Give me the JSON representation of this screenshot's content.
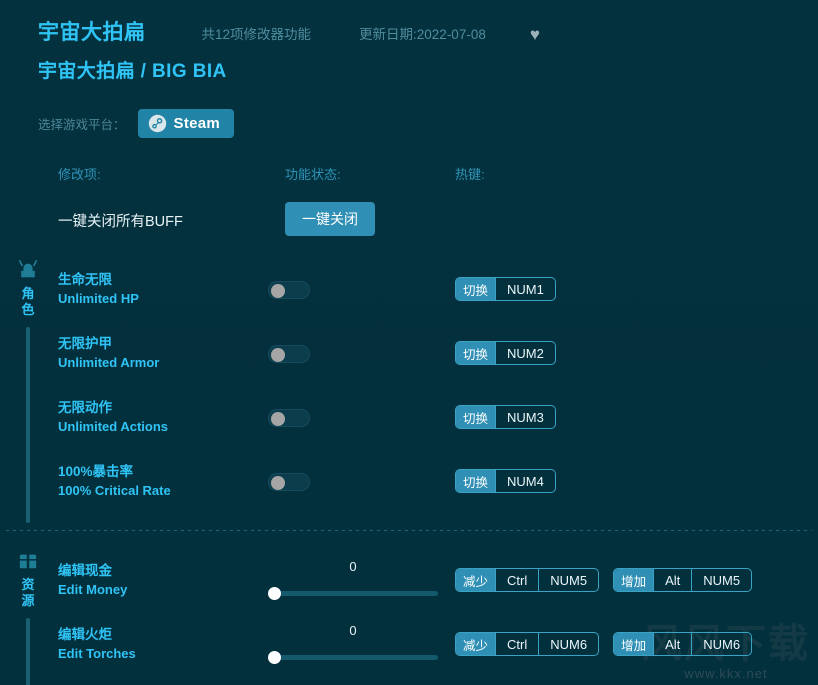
{
  "header": {
    "game_title": "宇宙大拍扁",
    "game_subtitle": "宇宙大拍扁 / BIG BIA",
    "feature_count": "共12项修改器功能",
    "update_date": "更新日期:2022-07-08",
    "favorite_icon": "heart-icon",
    "favorite_glyph": "♥"
  },
  "platform": {
    "label": "选择游戏平台：",
    "selected": "Steam",
    "icon": "steam-icon"
  },
  "columns": {
    "modifier": "修改项:",
    "state": "功能状态:",
    "hotkey": "热键:"
  },
  "onekey": {
    "label": "一键关闭所有BUFF",
    "button": "一键关闭"
  },
  "sections": [
    {
      "name": "角色",
      "icon": "helmet-icon",
      "rows": [
        {
          "cn": "生命无限",
          "en": "Unlimited HP",
          "control": "toggle",
          "toggle_on": false,
          "keys": [
            {
              "action": "切换",
              "combo": [
                "NUM1"
              ]
            }
          ]
        },
        {
          "cn": "无限护甲",
          "en": "Unlimited Armor",
          "control": "toggle",
          "toggle_on": false,
          "keys": [
            {
              "action": "切换",
              "combo": [
                "NUM2"
              ]
            }
          ]
        },
        {
          "cn": "无限动作",
          "en": "Unlimited Actions",
          "control": "toggle",
          "toggle_on": false,
          "keys": [
            {
              "action": "切换",
              "combo": [
                "NUM3"
              ]
            }
          ]
        },
        {
          "cn": "100%暴击率",
          "en": "100% Critical Rate",
          "control": "toggle",
          "toggle_on": false,
          "keys": [
            {
              "action": "切换",
              "combo": [
                "NUM4"
              ]
            }
          ]
        }
      ]
    },
    {
      "name": "资源",
      "icon": "chest-icon",
      "rows": [
        {
          "cn": "编辑现金",
          "en": "Edit Money",
          "control": "slider",
          "value": "0",
          "percent": 0,
          "keys": [
            {
              "action": "减少",
              "combo": [
                "Ctrl",
                "NUM5"
              ]
            },
            {
              "action": "增加",
              "combo": [
                "Alt",
                "NUM5"
              ]
            }
          ]
        },
        {
          "cn": "编辑火炬",
          "en": "Edit Torches",
          "control": "slider",
          "value": "0",
          "percent": 0,
          "keys": [
            {
              "action": "减少",
              "combo": [
                "Ctrl",
                "NUM6"
              ]
            },
            {
              "action": "增加",
              "combo": [
                "Alt",
                "NUM6"
              ]
            }
          ]
        }
      ]
    }
  ],
  "watermark": {
    "glyph": "风风下载",
    "url": "www.kkx.net"
  },
  "colors": {
    "background": "#04313e",
    "accent": "#2fc4f5",
    "button": "#2f8fb4",
    "muted": "#4e8d9e"
  }
}
